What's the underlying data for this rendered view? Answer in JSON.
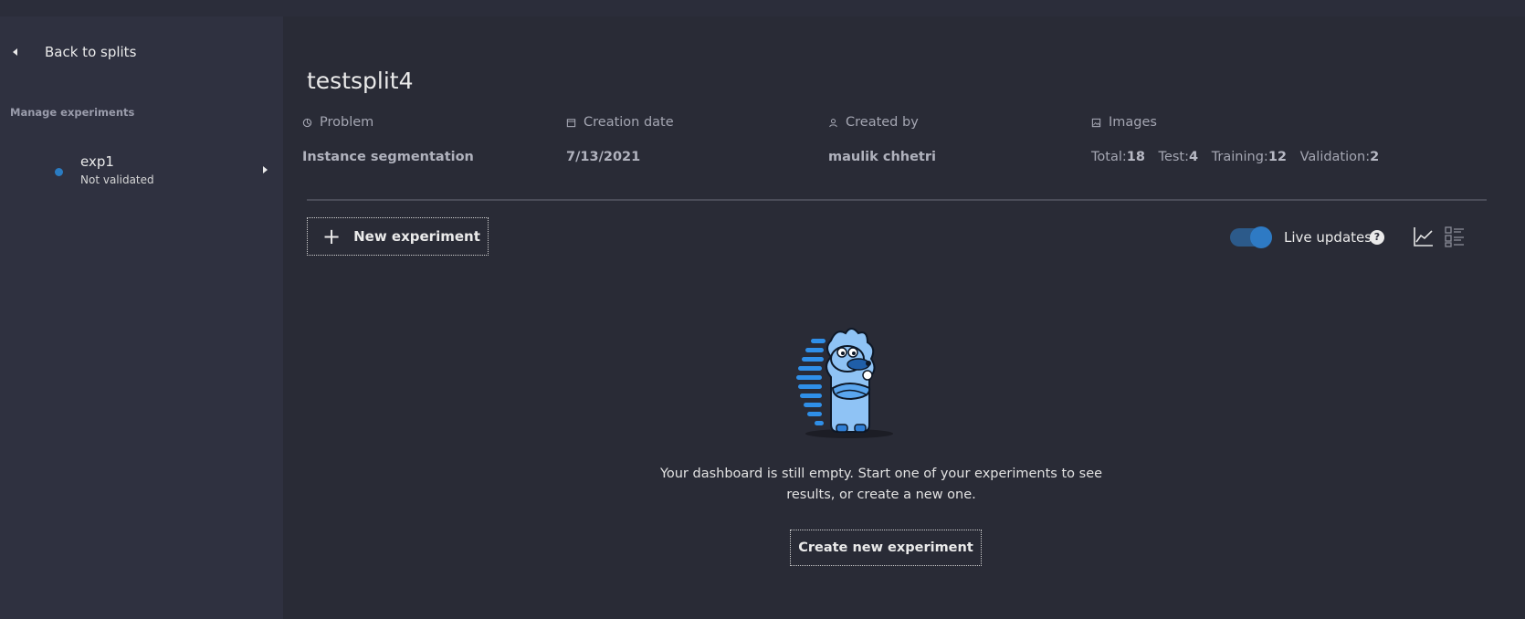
{
  "sidebar": {
    "back_label": "Back to splits",
    "section_title": "Manage experiments",
    "experiments": [
      {
        "name": "exp1",
        "status": "Not validated",
        "status_color": "#2a7cc2"
      }
    ]
  },
  "split": {
    "title": "testsplit4",
    "problem_label": "Problem",
    "problem_value": "Instance segmentation",
    "creation_label": "Creation date",
    "creation_value": "7/13/2021",
    "creator_label": "Created by",
    "creator_value": "maulik chhetri",
    "images_label": "Images",
    "images": {
      "total_label": "Total:",
      "total": "18",
      "test_label": "Test:",
      "test": "4",
      "training_label": "Training:",
      "training": "12",
      "validation_label": "Validation:",
      "validation": "2"
    }
  },
  "toolbar": {
    "new_experiment_label": "New experiment",
    "live_updates_label": "Live updates",
    "live_updates_on": true,
    "help_glyph": "?"
  },
  "empty_state": {
    "message": "Your dashboard is still empty. Start one of your experiments to see results, or create a new one.",
    "create_label": "Create new experiment"
  },
  "colors": {
    "accent": "#2e7ac4",
    "background": "#292b36",
    "sidebar": "#2f3140"
  }
}
